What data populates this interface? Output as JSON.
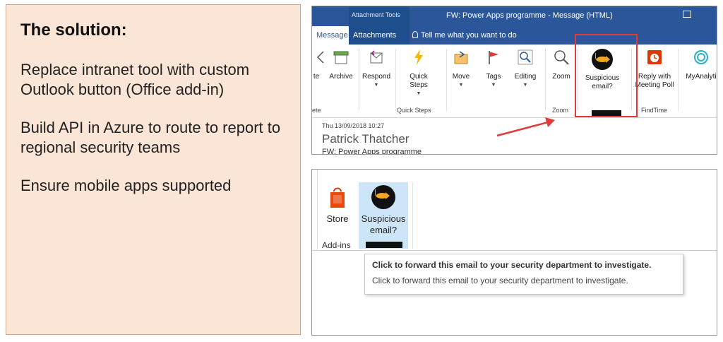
{
  "left": {
    "heading": "The solution:",
    "points": [
      "Replace intranet tool with custom Outlook button (Office add-in)",
      "Build API in Azure to route to report to regional security teams",
      "Ensure mobile apps supported"
    ]
  },
  "top": {
    "title_context": "Attachment Tools",
    "window_title": "FW: Power Apps programme  -  Message (HTML)",
    "tabs": [
      "Message",
      "Attachments"
    ],
    "tell_me": "Tell me what you want to do",
    "ribbon": {
      "partial_left": "te",
      "archive": "Archive",
      "respond": "Respond",
      "quick_steps": "Quick Steps",
      "move": "Move",
      "tags": "Tags",
      "editing": "Editing",
      "zoom": "Zoom",
      "suspicious": "Suspicious email?",
      "reply_meeting": "Reply with Meeting Poll",
      "myanalytics": "MyAnalyti"
    },
    "groups": {
      "partial": "ete",
      "quick_steps": "Quick Steps",
      "zoom": "Zoom",
      "findtime": "FindTime"
    },
    "mail": {
      "date": "Thu 13/09/2018 10:27",
      "sender": "Patrick Thatcher",
      "subject": "FW: Power Apps programme"
    }
  },
  "bottom": {
    "store": "Store",
    "suspicious": "Suspicious email?",
    "group": "Add-ins",
    "tooltip_title": "Click to forward this email to your security department to investigate.",
    "tooltip_desc": "Click to forward this email to your security department to investigate."
  },
  "colors": {
    "outlook_blue": "#2b579a",
    "highlight_red": "#e03a3a",
    "panel_bg": "#fbe5d6",
    "selected_btn": "#cde6f7"
  }
}
